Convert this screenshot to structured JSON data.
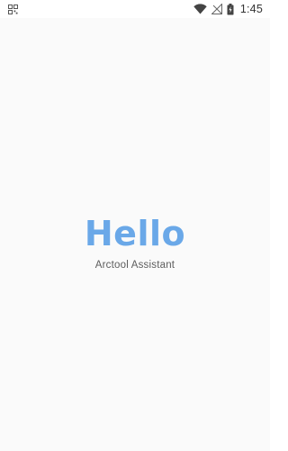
{
  "status_bar": {
    "time": "1:45",
    "icons": {
      "left": "notification-grid-icon",
      "wifi": "wifi-icon",
      "signal": "no-sim-signal-icon",
      "battery": "battery-charging-icon"
    }
  },
  "main": {
    "greeting": "Hello",
    "subtitle": "Arctool Assistant"
  },
  "colors": {
    "greeting": "#6aa8e8",
    "background": "#fafafa",
    "subtitle": "#5d5d5d"
  }
}
